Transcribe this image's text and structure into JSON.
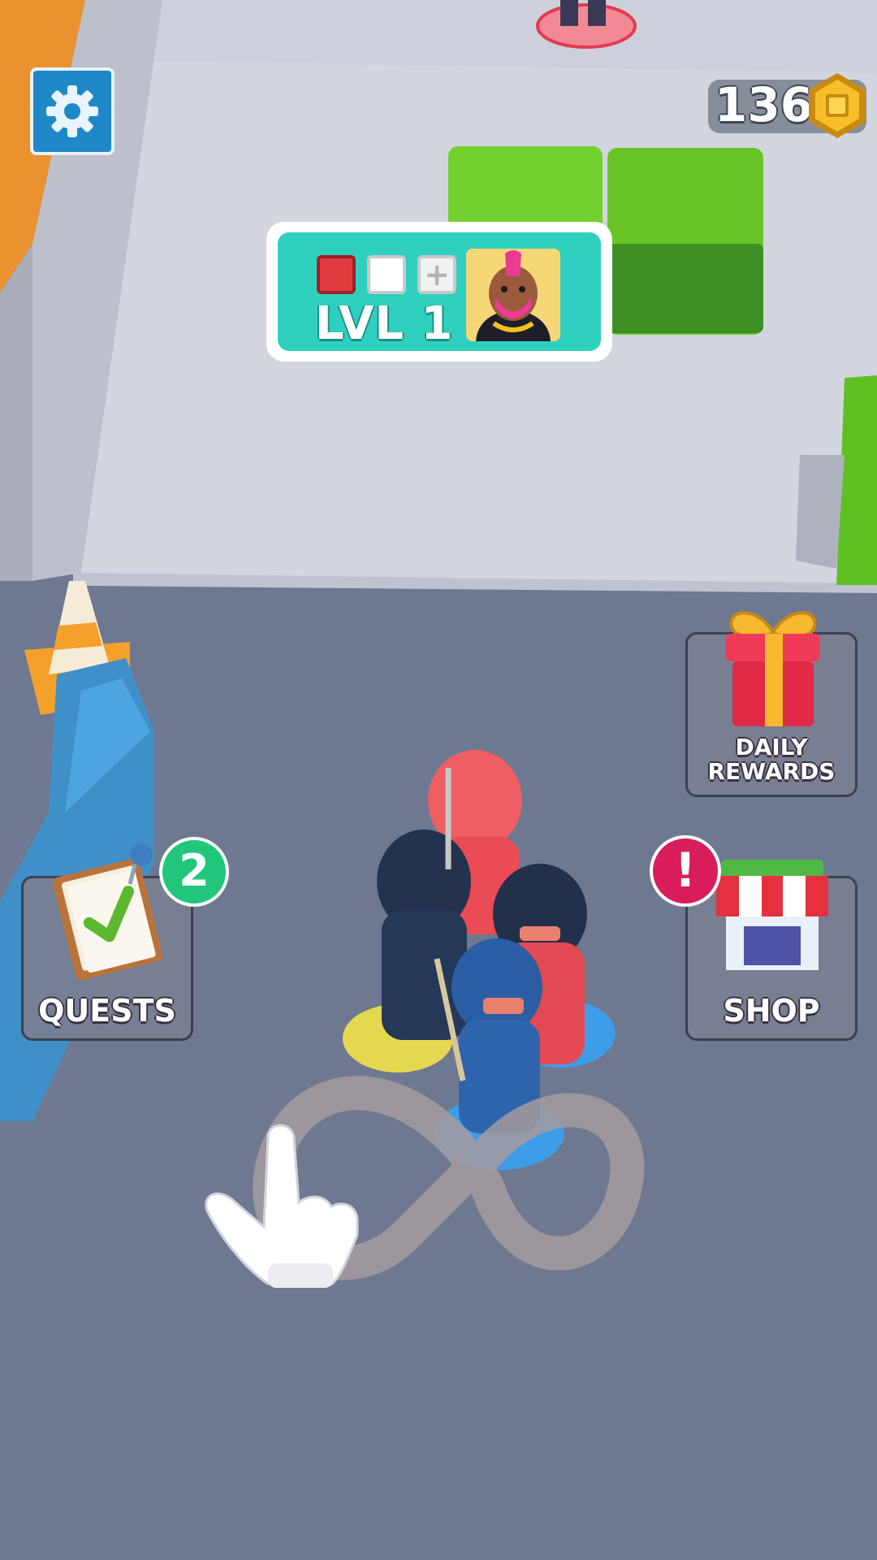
{
  "hud": {
    "coins": "136",
    "level_label": "LVL 1"
  },
  "buttons": {
    "daily_rewards_line1": "DAILY",
    "daily_rewards_line2": "REWARDS",
    "quests_label": "QUESTS",
    "quests_badge": "2",
    "shop_label": "SHOP",
    "shop_badge": "!"
  },
  "level_slots": {
    "add_symbol": "+"
  },
  "icons": [
    "settings-gear-icon",
    "coin-icon",
    "boss-portrait",
    "gift-box-icon",
    "clipboard-check-icon",
    "shop-stall-icon",
    "tutorial-hand-icon",
    "infinity-swipe-path"
  ],
  "colors": {
    "settings_button": "#1e88c8",
    "level_panel": "#2fcfbf",
    "quest_badge": "#20c77a",
    "shop_badge": "#d81d5a"
  }
}
